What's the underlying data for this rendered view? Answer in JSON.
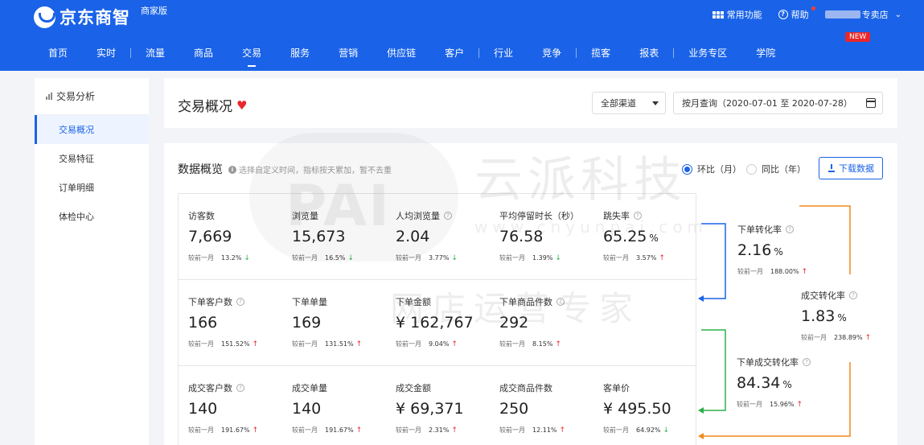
{
  "brand": {
    "name": "京东商智",
    "edition": "商家版"
  },
  "top_right": {
    "common_label": "常用功能",
    "help_label": "帮助",
    "shop_suffix": "专卖店"
  },
  "nav": {
    "tabs": [
      "首页",
      "实时",
      "流量",
      "商品",
      "交易",
      "服务",
      "营销",
      "供应链",
      "客户",
      "行业",
      "竞争",
      "揽客",
      "报表",
      "业务专区",
      "学院"
    ],
    "active": "交易",
    "new_badge": "NEW"
  },
  "sidebar": {
    "header": "交易分析",
    "items": [
      "交易概况",
      "交易特征",
      "订单明细",
      "体检中心"
    ],
    "active": "交易概况"
  },
  "title_card": {
    "title": "交易概况",
    "channel": "全部渠道",
    "date_range": "按月查询（2020-07-01 至 2020-07-28）"
  },
  "overview": {
    "title": "数据概览",
    "hint": "选择自定义时间，指标按天累加，暂不去重",
    "radio_mom": "环比（月）",
    "radio_yoy": "同比（年）",
    "download": "下载数据",
    "compare_label": "较前一月"
  },
  "metrics": [
    [
      {
        "label": "访客数",
        "value": "7,669",
        "pct": "13.2%",
        "dir": "down",
        "help": false
      },
      {
        "label": "浏览量",
        "value": "15,673",
        "pct": "16.5%",
        "dir": "down",
        "help": false
      },
      {
        "label": "人均浏览量",
        "value": "2.04",
        "pct": "3.77%",
        "dir": "down",
        "help": true
      },
      {
        "label": "平均停留时长（秒）",
        "value": "76.58",
        "pct": "1.39%",
        "dir": "down",
        "help": false
      },
      {
        "label": "跳失率",
        "value": "65.25",
        "unit": "%",
        "pct": "3.57%",
        "dir": "up",
        "help": true
      }
    ],
    [
      {
        "label": "下单客户数",
        "value": "166",
        "pct": "151.52%",
        "dir": "up",
        "help": true
      },
      {
        "label": "下单单量",
        "value": "169",
        "pct": "131.51%",
        "dir": "up",
        "help": false
      },
      {
        "label": "下单金额",
        "value": "¥ 162,767",
        "pct": "9.04%",
        "dir": "up",
        "help": false
      },
      {
        "label": "下单商品件数",
        "value": "292",
        "pct": "8.15%",
        "dir": "up",
        "help": true
      }
    ],
    [
      {
        "label": "成交客户数",
        "value": "140",
        "pct": "191.67%",
        "dir": "up",
        "help": true
      },
      {
        "label": "成交单量",
        "value": "140",
        "pct": "191.67%",
        "dir": "up",
        "help": false
      },
      {
        "label": "成交金额",
        "value": "¥ 69,371",
        "pct": "2.31%",
        "dir": "up",
        "help": false
      },
      {
        "label": "成交商品件数",
        "value": "250",
        "pct": "12.11%",
        "dir": "up",
        "help": false
      },
      {
        "label": "客单价",
        "value": "¥ 495.50",
        "pct": "64.92%",
        "dir": "down",
        "help": false
      }
    ]
  ],
  "conversions": [
    {
      "label": "下单转化率",
      "value": "2.16",
      "unit": "%",
      "pct": "188.00%",
      "dir": "up"
    },
    {
      "label": "成交转化率",
      "value": "1.83",
      "unit": "%",
      "pct": "238.89%",
      "dir": "up"
    },
    {
      "label": "下单成交转化率",
      "value": "84.34",
      "unit": "%",
      "pct": "15.96%",
      "dir": "up"
    }
  ],
  "watermark": {
    "cn": "云派科技",
    "pai": "PAI",
    "url": "www.cnyunpai.com",
    "sub": "网店运营专家"
  },
  "colors": {
    "primary": "#1a63e8",
    "up": "#e8282b",
    "down": "#2ab04a",
    "flow_blue": "#1a63e8",
    "flow_green": "#2ab04a",
    "flow_orange": "#f08a1c"
  }
}
